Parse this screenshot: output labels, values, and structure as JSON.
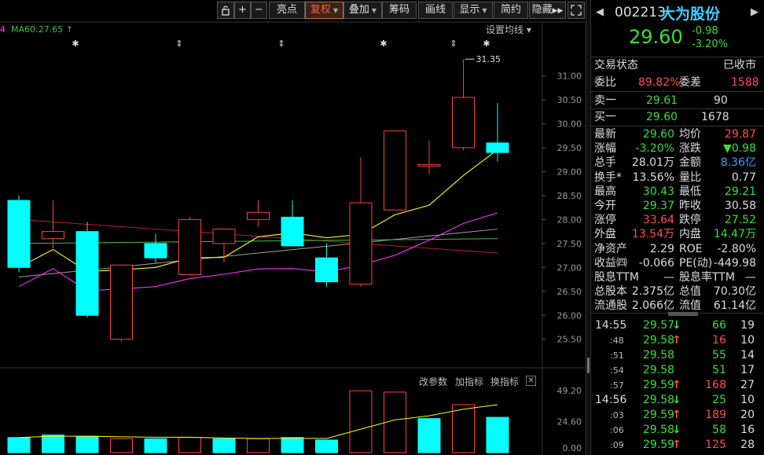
{
  "toolbar": {
    "lock_icon": "lock-icon",
    "plus": "+",
    "minus": "−",
    "buttons": [
      "亮点",
      "复权",
      "叠加",
      "筹码",
      "画线",
      "显示",
      "简约",
      "隐藏"
    ],
    "selected": "复权",
    "fullscreen_icon": "fullscreen-icon"
  },
  "ma_legend": {
    "prefix": "4",
    "ma60": "MA60:27.65"
  },
  "settings_label": "设置均线",
  "price_axis": [
    "31.00",
    "30.50",
    "30.00",
    "29.50",
    "29.00",
    "28.50",
    "28.00",
    "27.50",
    "27.00",
    "26.50",
    "26.00",
    "25.50"
  ],
  "high_marker": "31.35",
  "indicator": {
    "change_params": "改参数",
    "add_indicator": "加指标",
    "switch_indicator": "换指标",
    "axis": [
      "49.20",
      "24.60",
      "0.00"
    ]
  },
  "chart_data": {
    "type": "candlestick",
    "candles": [
      {
        "open": 28.4,
        "close": 27.0,
        "high": 28.5,
        "low": 26.9
      },
      {
        "open": 27.6,
        "close": 27.75,
        "high": 28.4,
        "low": 27.4
      },
      {
        "open": 27.75,
        "close": 26.0,
        "high": 27.95,
        "low": 25.95
      },
      {
        "open": 25.5,
        "close": 27.05,
        "high": 27.05,
        "low": 25.45
      },
      {
        "open": 27.5,
        "close": 27.2,
        "high": 27.7,
        "low": 27.1
      },
      {
        "open": 26.85,
        "close": 28.0,
        "high": 28.05,
        "low": 26.85
      },
      {
        "open": 27.5,
        "close": 27.8,
        "high": 27.8,
        "low": 27.1
      },
      {
        "open": 28.0,
        "close": 28.15,
        "high": 28.4,
        "low": 27.85
      },
      {
        "open": 28.05,
        "close": 27.45,
        "high": 28.4,
        "low": 27.45
      },
      {
        "open": 27.2,
        "close": 26.7,
        "high": 27.5,
        "low": 26.6
      },
      {
        "open": 26.65,
        "close": 28.35,
        "high": 29.3,
        "low": 26.6
      },
      {
        "open": 28.2,
        "close": 29.85,
        "high": 29.85,
        "low": 28.2
      },
      {
        "open": 29.15,
        "close": 29.15,
        "high": 29.65,
        "low": 28.95
      },
      {
        "open": 29.5,
        "close": 30.55,
        "high": 31.35,
        "low": 29.45
      },
      {
        "open": 29.6,
        "close": 29.4,
        "high": 30.43,
        "low": 29.21
      }
    ],
    "volume": [
      {
        "value": 12,
        "up": false
      },
      {
        "value": 14,
        "up": false
      },
      {
        "value": 13,
        "up": false
      },
      {
        "value": 11,
        "up": true
      },
      {
        "value": 11,
        "up": false
      },
      {
        "value": 12,
        "up": true
      },
      {
        "value": 11,
        "up": false
      },
      {
        "value": 11,
        "up": true
      },
      {
        "value": 12,
        "up": false
      },
      {
        "value": 10,
        "up": false
      },
      {
        "value": 49,
        "up": true
      },
      {
        "value": 48,
        "up": true
      },
      {
        "value": 27,
        "up": false
      },
      {
        "value": 38,
        "up": true
      },
      {
        "value": 28.01,
        "up": false
      }
    ],
    "ylim": [
      25.2,
      31.6
    ],
    "vol_ylim": [
      0,
      49.2
    ]
  },
  "quote": {
    "code": "002213",
    "name": "大为股份",
    "price": "29.60",
    "change": "-0.98",
    "change_pct": "-3.20%",
    "trade_status_label": "交易状态",
    "trade_status": "已收市",
    "weibi_label": "委比",
    "weibi": "89.82%",
    "weicha_label": "委差",
    "weicha": "1588",
    "sell1_label": "卖一",
    "sell1_price": "29.61",
    "sell1_vol": "90",
    "buy1_label": "买一",
    "buy1_price": "29.60",
    "buy1_vol": "1678",
    "stats": [
      {
        "l1": "最新",
        "v1": "29.60",
        "c1": "g",
        "l2": "均价",
        "v2": "29.87",
        "c2": "r"
      },
      {
        "l1": "涨幅",
        "v1": "-3.20%",
        "c1": "g",
        "l2": "涨跌",
        "v2": "▼0.98",
        "c2": "g"
      },
      {
        "l1": "总手",
        "v1": "28.01万",
        "c1": "w",
        "l2": "金额",
        "v2": "8.36亿",
        "c2": "b"
      },
      {
        "l1": "换手*",
        "v1": "13.56%",
        "c1": "w",
        "l2": "量比",
        "v2": "0.77",
        "c2": "w"
      },
      {
        "l1": "最高",
        "v1": "30.43",
        "c1": "g",
        "l2": "最低",
        "v2": "29.21",
        "c2": "g"
      },
      {
        "l1": "今开",
        "v1": "29.37",
        "c1": "g",
        "l2": "昨收",
        "v2": "30.58",
        "c2": "w"
      },
      {
        "l1": "涨停",
        "v1": "33.64",
        "c1": "r",
        "l2": "跌停",
        "v2": "27.52",
        "c2": "g"
      },
      {
        "l1": "外盘",
        "v1": "13.54万",
        "c1": "r",
        "l2": "内盘",
        "v2": "14.47万",
        "c2": "g"
      },
      {
        "l1": "净资产",
        "v1": "2.29",
        "c1": "w",
        "l2": "ROE",
        "v2": "-2.80%",
        "c2": "w"
      },
      {
        "l1": "收益㈣",
        "v1": "-0.066",
        "c1": "w",
        "l2": "PE(动)",
        "v2": "-449.98",
        "c2": "w"
      },
      {
        "l1": "股息TTM",
        "v1": "—",
        "c1": "w",
        "l2": "股息率TTM",
        "v2": "—",
        "c2": "w"
      },
      {
        "l1": "总股本",
        "v1": "2.375亿",
        "c1": "w",
        "l2": "总值",
        "v2": "70.30亿",
        "c2": "w"
      },
      {
        "l1": "流通股",
        "v1": "2.066亿",
        "c1": "w",
        "l2": "流值",
        "v2": "61.14亿",
        "c2": "w"
      }
    ],
    "ticks": [
      {
        "time": "14:55",
        "price": "29.57",
        "dir": "down",
        "vol": "66",
        "cnt": "19"
      },
      {
        "time": ":48",
        "price": "29.58",
        "dir": "up",
        "vol": "16",
        "cnt": "10"
      },
      {
        "time": ":51",
        "price": "29.58",
        "dir": "",
        "vol": "55",
        "cnt": "14"
      },
      {
        "time": ":54",
        "price": "29.58",
        "dir": "",
        "vol": "51",
        "cnt": "17"
      },
      {
        "time": ":57",
        "price": "29.59",
        "dir": "up",
        "vol": "168",
        "cnt": "27"
      },
      {
        "time": "14:56",
        "price": "29.58",
        "dir": "down",
        "vol": "25",
        "cnt": "10"
      },
      {
        "time": ":03",
        "price": "29.59",
        "dir": "up",
        "vol": "189",
        "cnt": "20"
      },
      {
        "time": ":06",
        "price": "29.58",
        "dir": "down",
        "vol": "58",
        "cnt": "16"
      },
      {
        "time": ":09",
        "price": "29.59",
        "dir": "up",
        "vol": "125",
        "cnt": "28"
      }
    ]
  },
  "colors": {
    "up": "#ff4040",
    "down": "#00ffff",
    "ma5": "#ffff00",
    "ma10": "#ff30ff",
    "ma20": "#40c040",
    "ma30": "#a0a0a0",
    "ma60": "#c02020"
  }
}
